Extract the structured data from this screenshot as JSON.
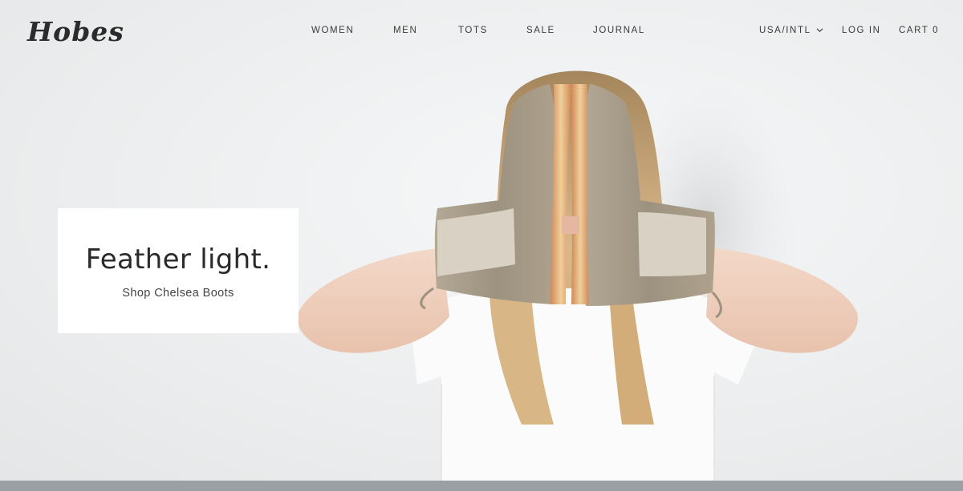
{
  "brand": {
    "logo_text": "Hobes"
  },
  "nav": {
    "main": [
      "WOMEN",
      "MEN",
      "TOTS",
      "SALE",
      "JOURNAL"
    ],
    "region": "USA/INTL",
    "login": "LOG IN",
    "cart": "CART 0"
  },
  "promo": {
    "headline": "Feather light.",
    "link": "Shop Chelsea Boots"
  },
  "colors": {
    "background": "#eef0f1",
    "text": "#2a2a2a",
    "footer_bar": "#9aa0a3",
    "suede": "#a29683",
    "sole": "#d9a766"
  },
  "icons": [
    "chevron-down-icon"
  ]
}
